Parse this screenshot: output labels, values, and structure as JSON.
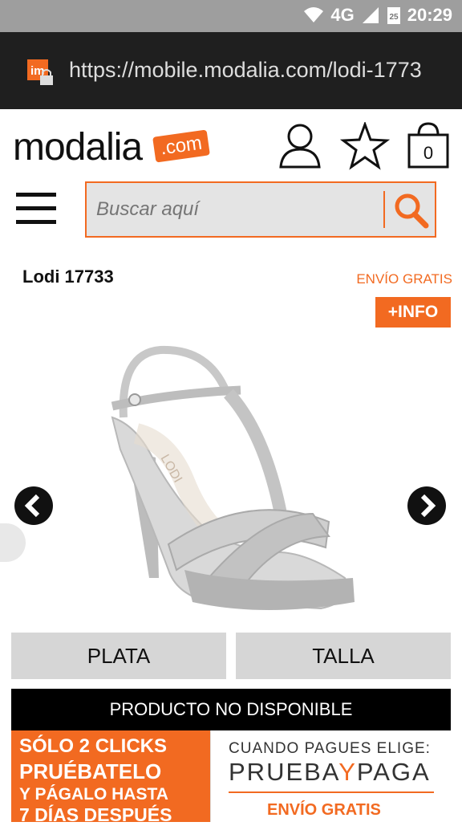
{
  "status_bar": {
    "network": "4G",
    "time": "20:29",
    "calendar_day": "25"
  },
  "browser": {
    "url": "https://mobile.modalia.com/lodi-1773"
  },
  "header": {
    "logo_text": "modalia",
    "logo_badge": ".com",
    "cart_count": "0"
  },
  "search": {
    "placeholder": "Buscar aquí"
  },
  "product": {
    "title": "Lodi 17733",
    "shipping_note": "ENVÍO GRATIS",
    "info_label": "+INFO",
    "brand_on_insole": "LODI",
    "color_option": "PLATA",
    "size_option": "TALLA",
    "availability": "PRODUCTO NO DISPONIBLE"
  },
  "promo": {
    "left_line1": "SÓLO 2 CLICKS",
    "left_line2": "PRUÉBATELO",
    "left_line3": "Y PÁGALO HASTA",
    "left_line4": "7 DÍAS DESPUÉS",
    "right_line1": "CUANDO PAGUES ELIGE:",
    "right_brand_a": "PRUEBA",
    "right_brand_y": "Y",
    "right_brand_b": "PAGA",
    "right_line3": "ENVÍO GRATIS"
  },
  "colors": {
    "accent": "#f26a21",
    "url_bar": "#1f1f1f",
    "status_bar": "#9e9e9e"
  }
}
